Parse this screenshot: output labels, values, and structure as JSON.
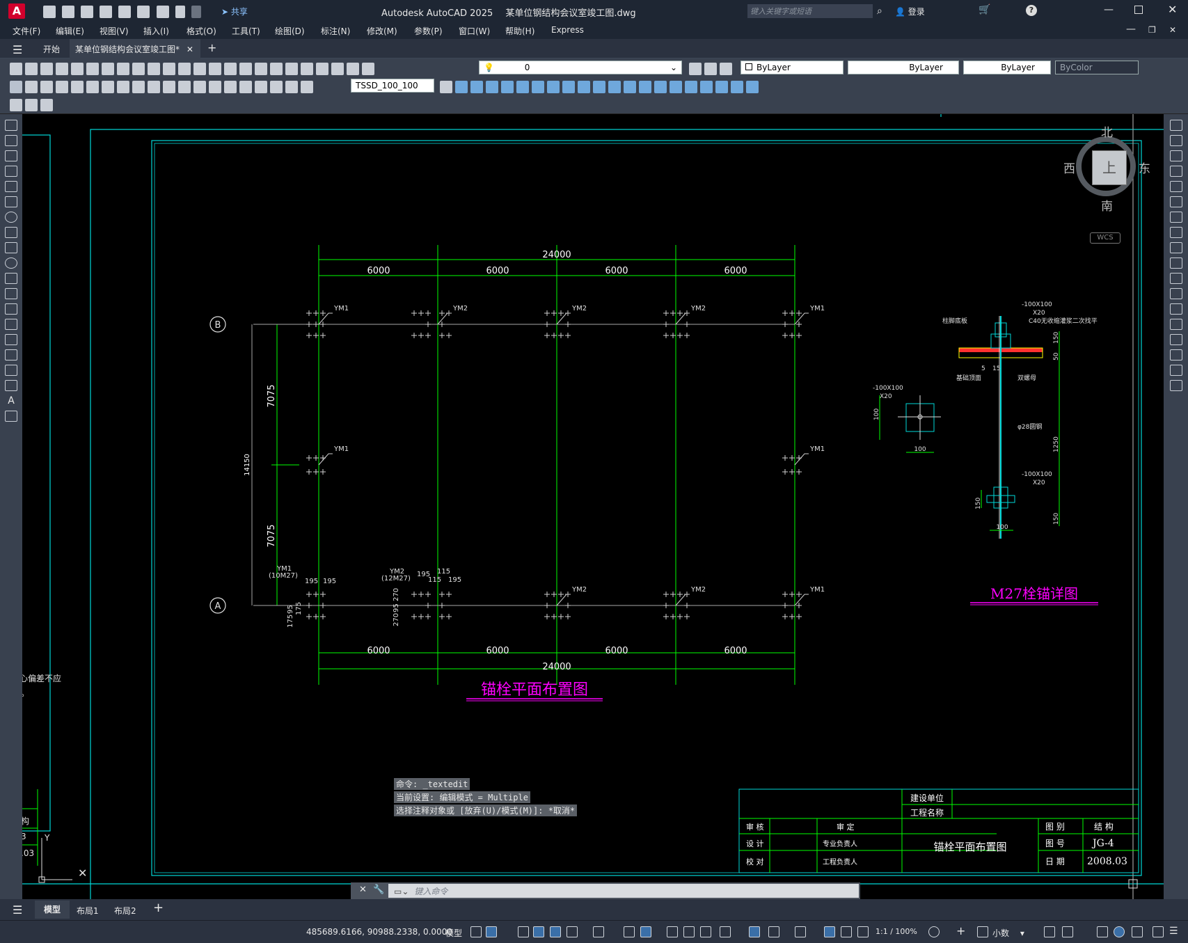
{
  "app": {
    "logo_letter": "A",
    "title": "Autodesk AutoCAD 2025",
    "document": "某单位钢结构会议室竣工图.dwg",
    "share": "共享",
    "search_placeholder": "键入关键字或短语",
    "login": "登录"
  },
  "menu": [
    "文件(F)",
    "编辑(E)",
    "视图(V)",
    "插入(I)",
    "格式(O)",
    "工具(T)",
    "绘图(D)",
    "标注(N)",
    "修改(M)",
    "参数(P)",
    "窗口(W)",
    "帮助(H)",
    "Express"
  ],
  "doc_tabs": {
    "start": "开始",
    "active": "某单位钢结构会议室竣工图*"
  },
  "toolbar": {
    "layer": "0",
    "color": "ByLayer",
    "linetype": "ByLayer",
    "lineweight": "ByLayer",
    "plotstyle": "ByColor",
    "dimstyle": "TSSD_100_100"
  },
  "viewcube": {
    "north": "北",
    "south": "南",
    "east": "东",
    "west": "西",
    "top": "上",
    "wcs": "WCS"
  },
  "drawing": {
    "plan_title": "锚栓平面布置图",
    "detail_title": "M27栓锚详图",
    "dims_top_total": "24000",
    "dims_span": "6000",
    "dim_7075": "7075",
    "dim_14150": "14150",
    "axis_b": "B",
    "axis_a": "A",
    "ym1": "YM1",
    "ym2": "YM2",
    "ym1_spec": "(10M27)",
    "ym2_spec": "(12M27)",
    "n175": "175",
    "n195": "195",
    "n95": "95",
    "n115": "115",
    "n270": "270",
    "detail_plate": "-100X100",
    "detail_x20": "X20",
    "detail_c40": "C40无收缩灌浆二次找平",
    "detail_base": "柱脚底板",
    "detail_top": "基础顶面",
    "detail_nut": "双螺母",
    "detail_rod": "φ28圆钢",
    "n100": "100",
    "n150": "150",
    "n50": "50",
    "n1250": "1250",
    "n5": "5",
    "n15": "15",
    "left_note1": "心偏差不应",
    "left_note2": "。",
    "left_tb1": "构",
    "left_tb2": "3",
    "left_tb3": ".03"
  },
  "titleblock": {
    "client": "建设单位",
    "project": "工程名称",
    "review": "审 核",
    "approve": "审 定",
    "design": "设 计",
    "prof_lead": "专业负责人",
    "check": "校 对",
    "eng_lead": "工程负责人",
    "drawing_name": "锚栓平面布置图",
    "category_label": "图 别",
    "category_value": "结 构",
    "number_label": "图 号",
    "number_value": "JG-4",
    "date_label": "日 期",
    "date_value": "2008.03"
  },
  "command": {
    "line1": "命令: _textedit",
    "line2": "当前设置: 编辑模式 = Multiple",
    "line3": "选择注释对象或 [放弃(U)/模式(M)]: *取消*",
    "placeholder": "键入命令"
  },
  "layouts": {
    "model": "模型",
    "layout1": "布局1",
    "layout2": "布局2"
  },
  "status": {
    "coords": "485689.6166, 90988.2338, 0.0000",
    "space": "模型",
    "scale": "1:1 / 100%",
    "units": "小数"
  },
  "colors": {
    "cyan": "#00d8d8",
    "green": "#00ff00",
    "magenta": "#ff00ff",
    "yellow": "#ffff00",
    "white": "#e0e0e0"
  }
}
